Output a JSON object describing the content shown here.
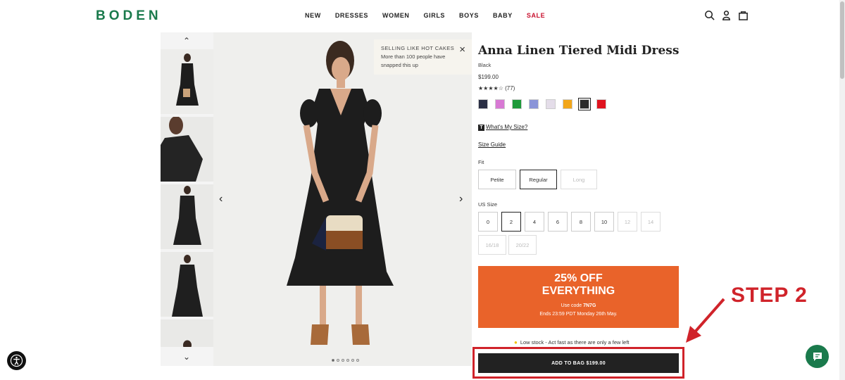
{
  "header": {
    "logo": "BODEN",
    "nav": [
      "NEW",
      "DRESSES",
      "WOMEN",
      "GIRLS",
      "BOYS",
      "BABY",
      "SALE"
    ],
    "icons": [
      "search-icon",
      "account-icon",
      "bag-icon"
    ]
  },
  "gallery": {
    "popup_title": "SELLING LIKE HOT CAKES",
    "popup_text": "More than 100 people have snapped this up",
    "thumbnail_count": 5,
    "dot_count": 6
  },
  "product": {
    "title": "Anna Linen Tiered Midi Dress",
    "color": "Black",
    "price": "$199.00",
    "stars": "★★★★☆",
    "review_count": "(77)",
    "swatches": [
      "#2a2f45",
      "#d879d4",
      "#1e9a3a",
      "#8a94d8",
      "#e4dde9",
      "#f2a619",
      "#2b2b2b",
      "#e0131f"
    ],
    "whats_my_size": "What's My Size?",
    "size_guide": "Size Guide",
    "fit_label": "Fit",
    "fits": [
      "Petite",
      "Regular",
      "Long"
    ],
    "size_label": "US Size",
    "sizes_row1": [
      "0",
      "2",
      "4",
      "6",
      "8",
      "10",
      "12",
      "14"
    ],
    "sizes_row2": [
      "16/18",
      "20/22"
    ],
    "stock_text": "Low stock - Act fast as there are only a few left",
    "add_to_bag": "ADD TO BAG $199.00"
  },
  "promo": {
    "line1": "25% OFF",
    "line2": "EVERYTHING",
    "code_text": "Use code ",
    "code": "7N7G",
    "ends": "Ends 23:59 PDT Monday 26th May."
  },
  "annotation": {
    "step_label": "STEP 2",
    "color": "#d0232a"
  }
}
